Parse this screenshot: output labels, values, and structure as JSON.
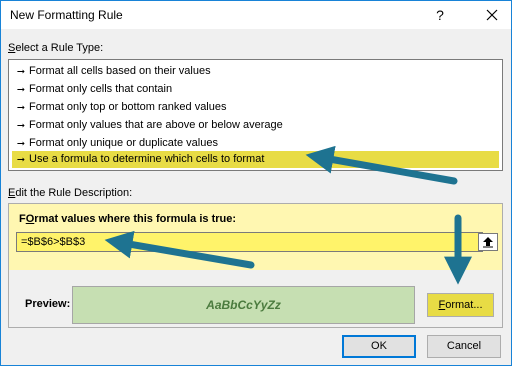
{
  "window": {
    "title": "New Formatting Rule",
    "help_glyph": "?",
    "close_icon": "close-icon"
  },
  "rule_type": {
    "label_accel": "S",
    "label_rest": "elect a Rule Type:",
    "selected_index": 5,
    "items": [
      {
        "label": "Format all cells based on their values"
      },
      {
        "label": "Format only cells that contain"
      },
      {
        "label": "Format only top or bottom ranked values"
      },
      {
        "label": "Format only values that are above or below average"
      },
      {
        "label": "Format only unique or duplicate values"
      },
      {
        "label": "Use a formula to determine which cells to format"
      }
    ]
  },
  "description": {
    "label_accel": "E",
    "label_rest": "dit the Rule Description:",
    "formula_label_accel": "O",
    "formula_label_pre": "F",
    "formula_label_rest": "rmat values where this formula is true:",
    "formula_value": "=$B$6>$B$3",
    "preview_label": "Preview:",
    "preview_text": "AaBbCcYyZz",
    "format_button_accel": "F",
    "format_button_rest": "ormat..."
  },
  "buttons": {
    "ok": "OK",
    "cancel": "Cancel"
  },
  "colors": {
    "highlight": "#e8dc45",
    "formula_bg": "#fff36a",
    "panel_bg": "#fff7b1",
    "preview_bg": "#c6dfb2",
    "arrow": "#1e7391"
  }
}
